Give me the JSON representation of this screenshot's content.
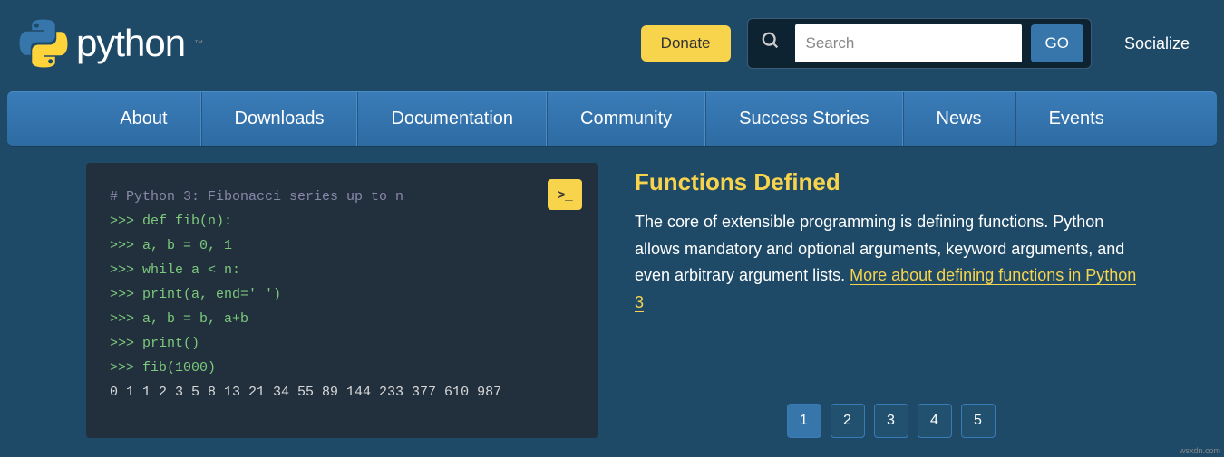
{
  "header": {
    "brand": "python",
    "tm": "™",
    "donate": "Donate",
    "search_placeholder": "Search",
    "go": "GO",
    "socialize": "Socialize"
  },
  "nav": {
    "items": [
      "About",
      "Downloads",
      "Documentation",
      "Community",
      "Success Stories",
      "News",
      "Events"
    ]
  },
  "code": {
    "comment": "# Python 3: Fibonacci series up to n",
    "lines": [
      ">>> def fib(n):",
      ">>>     a, b = 0, 1",
      ">>>     while a < n:",
      ">>>         print(a, end=' ')",
      ">>>         a, b = b, a+b",
      ">>>     print()",
      ">>> fib(1000)"
    ],
    "output": "0 1 1 2 3 5 8 13 21 34 55 89 144 233 377 610 987",
    "shell_icon": ">_"
  },
  "info": {
    "title": "Functions Defined",
    "body": "The core of extensible programming is defining functions. Python allows mandatory and optional arguments, keyword arguments, and even arbitrary argument lists. ",
    "link": "More about defining functions in Python 3"
  },
  "pagination": {
    "pages": [
      "1",
      "2",
      "3",
      "4",
      "5"
    ],
    "active": "1"
  },
  "watermark": "wsxdn.com"
}
